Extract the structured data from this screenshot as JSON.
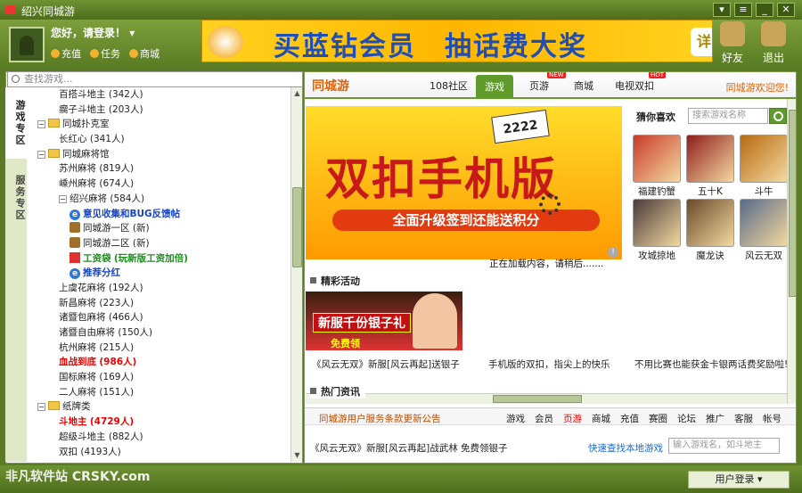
{
  "window": {
    "title": "绍兴同城游"
  },
  "header": {
    "greeting": "您好，请登录！",
    "links": [
      "充值",
      "任务",
      "商城"
    ],
    "banner_text": "买蓝钻会员　抽话费大奖",
    "banner_button": "详",
    "tools": [
      "好友",
      "退出"
    ]
  },
  "sidebar": {
    "search_placeholder": "查找游戏...",
    "tabs": [
      "游戏专区",
      "服务专区"
    ],
    "tree": [
      {
        "label": "百搭斗地主",
        "count": "(342人)",
        "indent": 3,
        "type": "leaf"
      },
      {
        "label": "瘸子斗地主",
        "count": "(203人)",
        "indent": 3,
        "type": "leaf"
      },
      {
        "label": "同城扑克室",
        "count": "",
        "indent": 1,
        "type": "folder"
      },
      {
        "label": "长红心",
        "count": "(341人)",
        "indent": 3,
        "type": "leaf"
      },
      {
        "label": "同城麻将馆",
        "count": "",
        "indent": 1,
        "type": "folder"
      },
      {
        "label": "苏州麻将",
        "count": "(819人)",
        "indent": 3,
        "type": "leaf"
      },
      {
        "label": "嵊州麻将",
        "count": "(674人)",
        "indent": 3,
        "type": "leaf"
      },
      {
        "label": "绍兴麻将",
        "count": "(584人)",
        "indent": 3,
        "type": "expand"
      },
      {
        "label": "意见收集和BUG反馈帖",
        "count": "",
        "indent": 4,
        "type": "ie",
        "style": "blue"
      },
      {
        "label": "同城游一区",
        "count": "(新)",
        "indent": 4,
        "type": "pin"
      },
      {
        "label": "同城游二区",
        "count": "(新)",
        "indent": 4,
        "type": "pin"
      },
      {
        "label": "工资袋",
        "count": "(玩新版工资加倍)",
        "indent": 4,
        "type": "gift",
        "style": "green"
      },
      {
        "label": "推荐分红",
        "count": "",
        "indent": 4,
        "type": "ie",
        "style": "blue"
      },
      {
        "label": "上虞花麻将",
        "count": "(192人)",
        "indent": 3,
        "type": "leaf"
      },
      {
        "label": "新昌麻将",
        "count": "(223人)",
        "indent": 3,
        "type": "leaf"
      },
      {
        "label": "诸暨包麻将",
        "count": "(466人)",
        "indent": 3,
        "type": "leaf"
      },
      {
        "label": "诸暨自由麻将",
        "count": "(150人)",
        "indent": 3,
        "type": "leaf"
      },
      {
        "label": "杭州麻将",
        "count": "(215人)",
        "indent": 3,
        "type": "leaf"
      },
      {
        "label": "血战到底",
        "count": "(986人)",
        "indent": 3,
        "type": "leaf",
        "style": "red"
      },
      {
        "label": "国标麻将",
        "count": "(169人)",
        "indent": 3,
        "type": "leaf"
      },
      {
        "label": "二人麻将",
        "count": "(151人)",
        "indent": 3,
        "type": "leaf"
      },
      {
        "label": "纸牌类",
        "count": "",
        "indent": 1,
        "type": "folder"
      },
      {
        "label": "斗地主",
        "count": "(4729人)",
        "indent": 3,
        "type": "leaf",
        "style": "red"
      },
      {
        "label": "超级斗地主",
        "count": "(882人)",
        "indent": 3,
        "type": "leaf"
      },
      {
        "label": "双扣",
        "count": "(4193人)",
        "indent": 3,
        "type": "leaf"
      }
    ]
  },
  "main": {
    "brand": "同城游",
    "tabs": [
      {
        "label": "108社区",
        "active": false,
        "badge": ""
      },
      {
        "label": "游戏",
        "active": true,
        "badge": ""
      },
      {
        "label": "页游",
        "active": false,
        "badge": "NEW"
      },
      {
        "label": "商城",
        "active": false,
        "badge": ""
      },
      {
        "label": "电视双扣",
        "active": false,
        "badge": "HOT"
      }
    ],
    "welcome": "同城游欢迎您!",
    "hero": {
      "title": "双扣手机版",
      "subtitle": "全面升级签到还能送积分",
      "cards": "2222"
    },
    "loading": "正在加载内容，请稍后.......",
    "guess_label": "猜你喜欢",
    "guess_placeholder": "搜索游戏名称",
    "games": [
      {
        "name": "福建钓蟹",
        "color": "#c83a2a"
      },
      {
        "name": "五十K",
        "color": "#8f1d1d"
      },
      {
        "name": "斗牛",
        "color": "#b86a10"
      },
      {
        "name": "攻城掠地",
        "color": "#4a3a3a"
      },
      {
        "name": "魔龙诀",
        "color": "#6a4a2a"
      },
      {
        "name": "风云无双",
        "color": "#5a6a8a"
      }
    ],
    "section_activity": "精彩活动",
    "promo": {
      "title": "新服千份银子礼",
      "sub": "免费领"
    },
    "captions": [
      "《风云无双》新服[风云再起]送银子",
      "手机版的双扣，指尖上的快乐",
      "不用比赛也能获金卡银两话费奖励啦!"
    ],
    "section_news": "热门资讯",
    "notice": "同城游用户服务条款更新公告",
    "bottom_links": [
      "游戏",
      "会员",
      "页游",
      "商城",
      "充值",
      "赛圈",
      "论坛",
      "推广",
      "客服",
      "帐号"
    ],
    "news_item": "《风云无双》新服[风云再起]战武林 免费领银子",
    "quick_link": "快速查找本地游戏",
    "quick_placeholder": "输入游戏名，如斗地主"
  },
  "statusbar": {
    "login": "用户登录",
    "watermark": "非凡软件站 CRSKY.com"
  }
}
